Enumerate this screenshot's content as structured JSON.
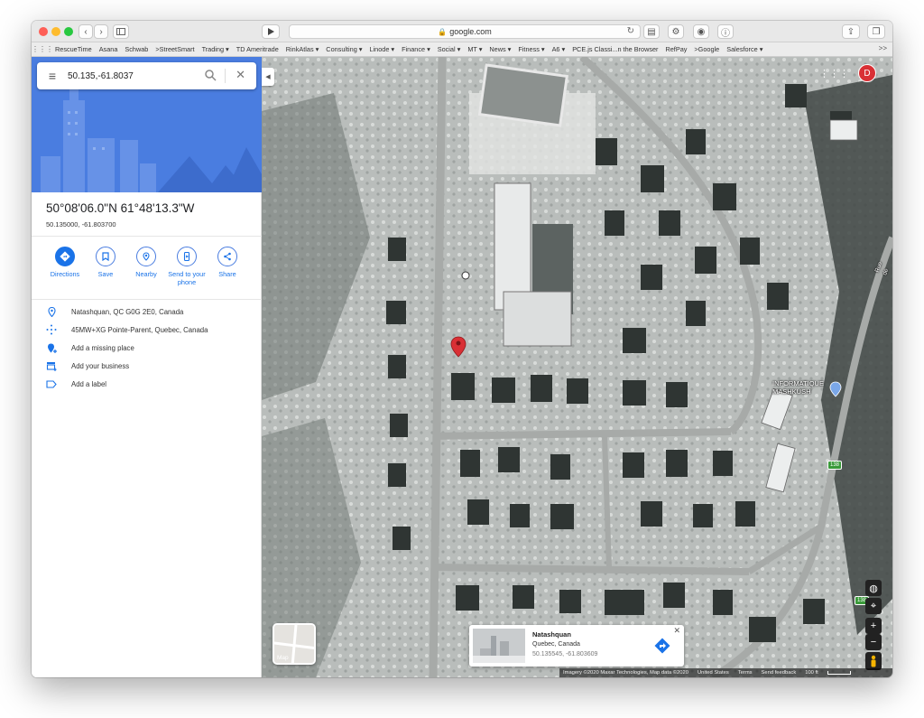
{
  "browser": {
    "url": "google.com",
    "bookmarks": [
      "RescueTime",
      "Asana",
      "Schwab",
      ">StreetSmart",
      "Trading ▾",
      "TD Ameritrade",
      "RinkAtlas ▾",
      "Consulting ▾",
      "Linode ▾",
      "Finance ▾",
      "Social ▾",
      "MT ▾",
      "News ▾",
      "Fitness ▾",
      "A6 ▾",
      "PCE.js Classi...n the Browser",
      "RefPay",
      ">Google",
      "Salesforce ▾"
    ],
    "more_label": ">>"
  },
  "search": {
    "value": "50.135,-61.8037"
  },
  "place": {
    "title": "50°08'06.0\"N 61°48'13.3\"W",
    "subtitle": "50.135000, -61.803700"
  },
  "actions": [
    {
      "label": "Directions"
    },
    {
      "label": "Save"
    },
    {
      "label": "Nearby"
    },
    {
      "label": "Send to your phone"
    },
    {
      "label": "Share"
    }
  ],
  "info": {
    "address": "Natashquan, QC G0G 2E0, Canada",
    "plus_code": "45MW+XG Pointe-Parent, Quebec, Canada",
    "add_missing_place": "Add a missing place",
    "add_business": "Add your business",
    "add_label": "Add a label"
  },
  "map": {
    "avatar_letter": "D",
    "layer_label": "Map",
    "poi_label": "INFORMATIQUE MASHKUSH",
    "street_label": "Rue de",
    "route_shield_1": "138",
    "route_shield_2": "138",
    "card": {
      "name": "Natashquan",
      "region": "Quebec, Canada",
      "coords": "50.135545, -61.803609"
    },
    "footer": {
      "imagery": "Imagery ©2020 Maxar Technologies, Map data ©2020",
      "country": "United States",
      "terms": "Terms",
      "feedback": "Send feedback",
      "scale": "100 ft"
    }
  },
  "colors": {
    "accent": "#1a73e8",
    "hero_bg": "#4a7de0",
    "pin": "#d93035"
  }
}
